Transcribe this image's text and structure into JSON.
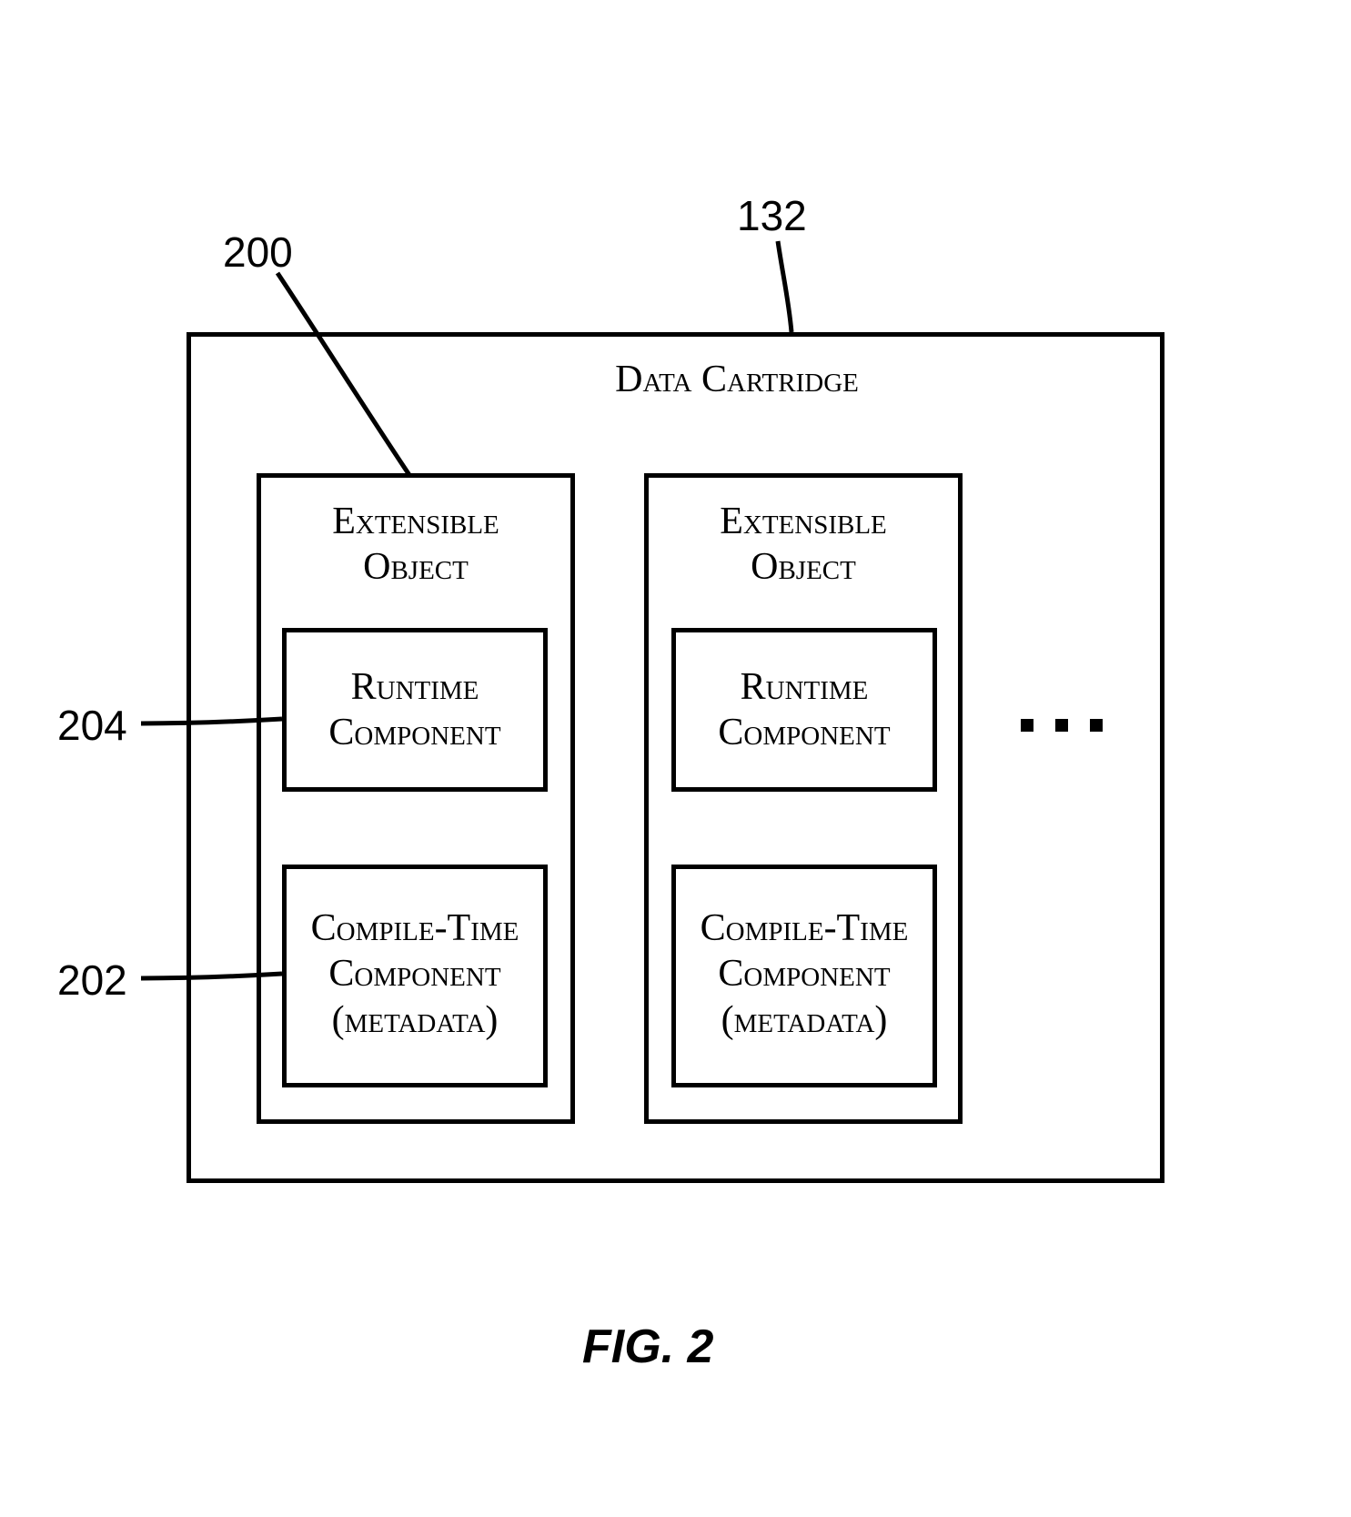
{
  "refs": {
    "r132": "132",
    "r200": "200",
    "r204": "204",
    "r202": "202"
  },
  "cartridge": {
    "title": "Data Cartridge",
    "objects": [
      {
        "title": "Extensible\nObject",
        "runtime": "Runtime\nComponent",
        "compile": "Compile-Time\nComponent\n(metadata)"
      },
      {
        "title": "Extensible\nObject",
        "runtime": "Runtime\nComponent",
        "compile": "Compile-Time\nComponent\n(metadata)"
      }
    ]
  },
  "figure_caption": "FIG. 2"
}
